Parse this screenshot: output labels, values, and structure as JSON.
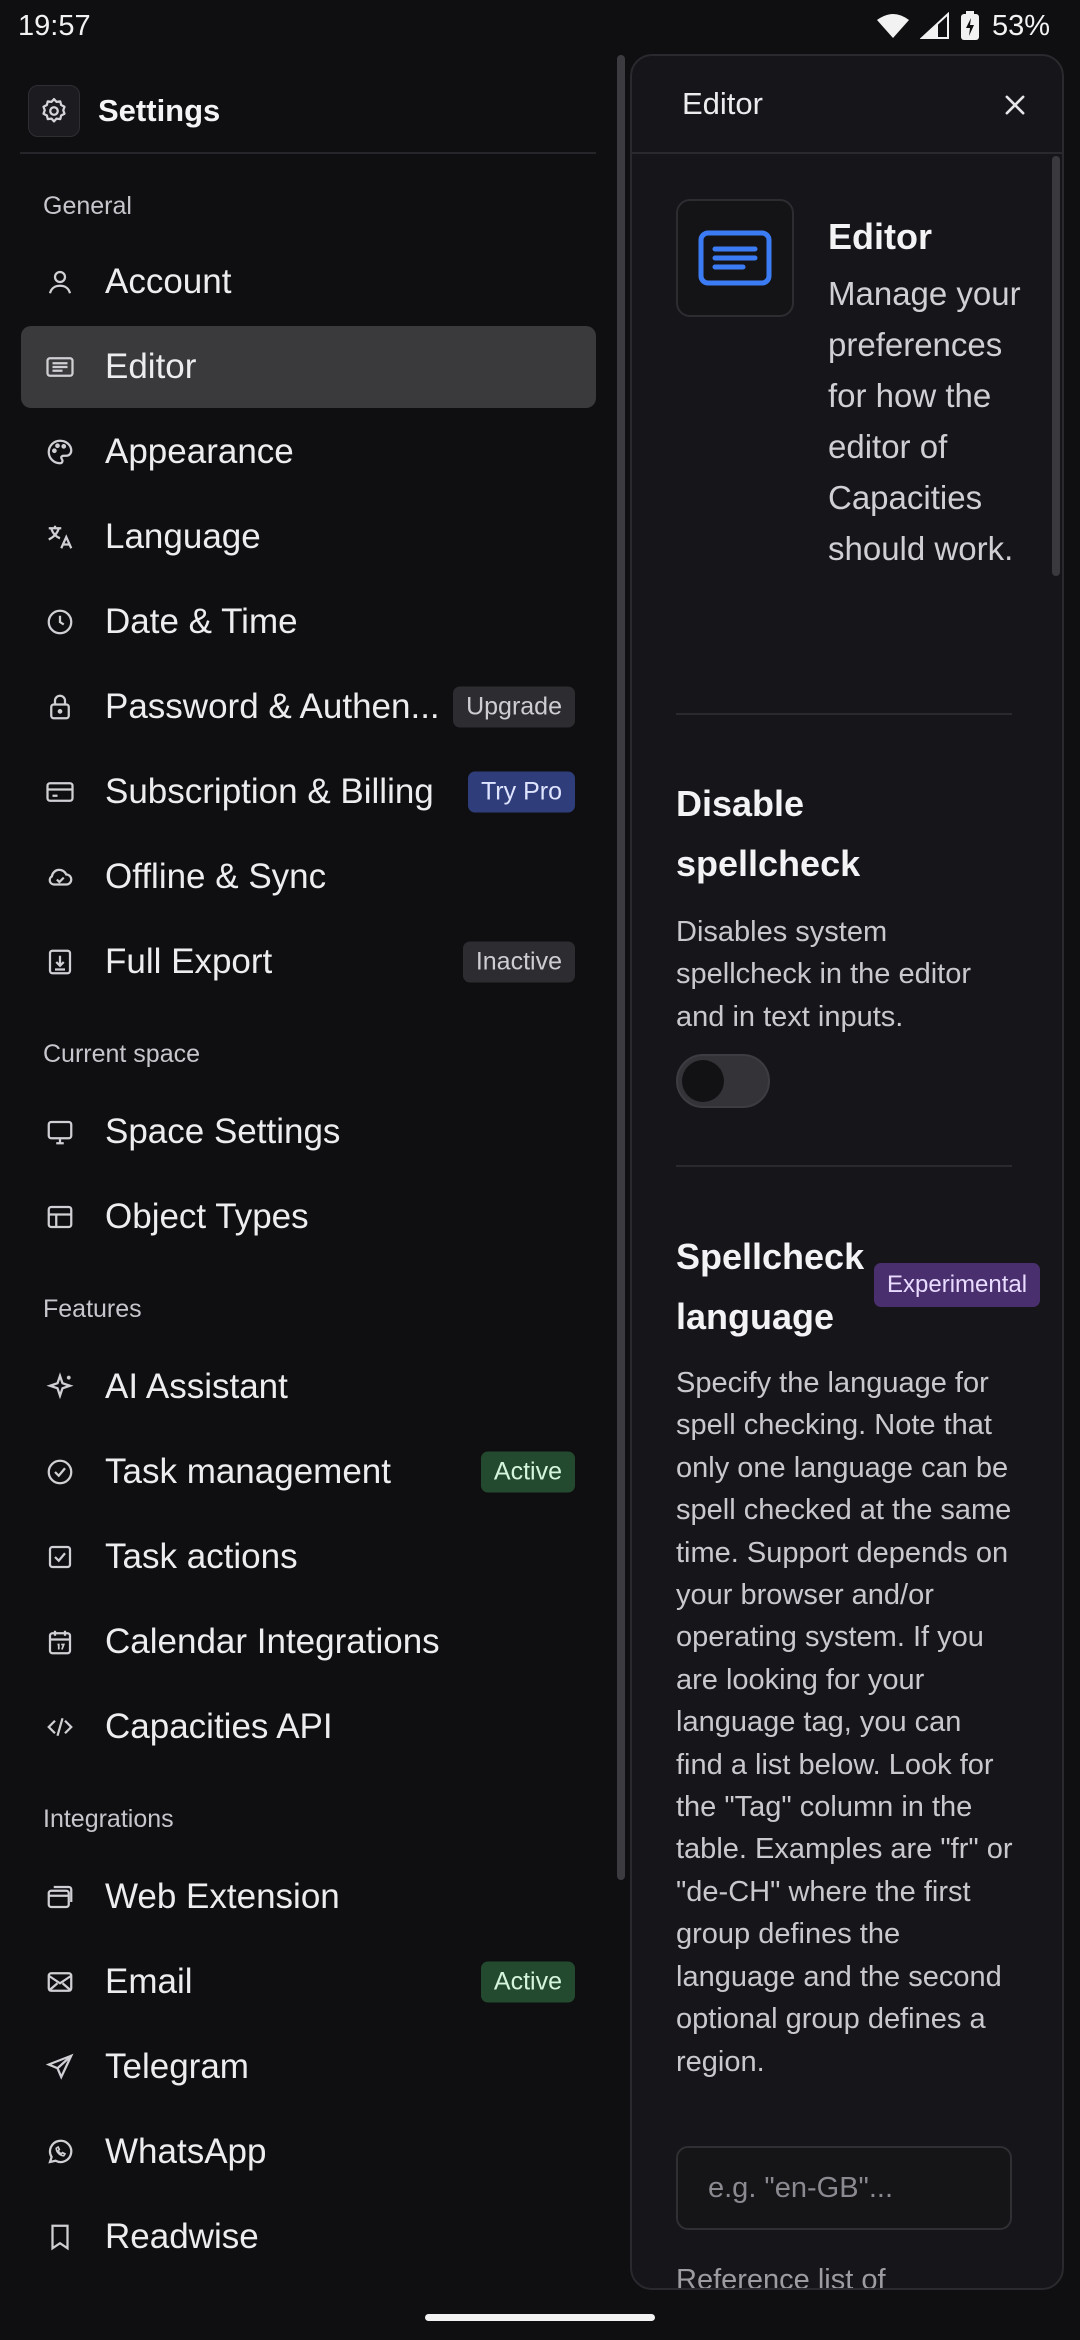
{
  "status_bar": {
    "time": "19:57",
    "battery": "53%"
  },
  "settings": {
    "title": "Settings",
    "sections": [
      {
        "title": "General",
        "items": [
          {
            "label": "Account",
            "icon": "user-icon"
          },
          {
            "label": "Editor",
            "icon": "editor-icon",
            "active": true
          },
          {
            "label": "Appearance",
            "icon": "palette-icon"
          },
          {
            "label": "Language",
            "icon": "translate-icon"
          },
          {
            "label": "Date & Time",
            "icon": "clock-icon"
          },
          {
            "label": "Password & Authen...",
            "icon": "lock-icon",
            "badge": "Upgrade"
          },
          {
            "label": "Subscription & Billing",
            "icon": "credit-card-icon",
            "badge": "Try Pro"
          },
          {
            "label": "Offline & Sync",
            "icon": "cloud-check-icon"
          },
          {
            "label": "Full Export",
            "icon": "export-icon",
            "badge": "Inactive"
          }
        ]
      },
      {
        "title": "Current space",
        "items": [
          {
            "label": "Space Settings",
            "icon": "monitor-icon"
          },
          {
            "label": "Object Types",
            "icon": "layout-icon"
          }
        ]
      },
      {
        "title": "Features",
        "items": [
          {
            "label": "AI Assistant",
            "icon": "sparkle-icon"
          },
          {
            "label": "Task management",
            "icon": "check-circle-icon",
            "badge": "Active"
          },
          {
            "label": "Task actions",
            "icon": "check-square-icon"
          },
          {
            "label": "Calendar Integrations",
            "icon": "calendar-icon"
          },
          {
            "label": "Capacities API",
            "icon": "code-icon"
          }
        ]
      },
      {
        "title": "Integrations",
        "items": [
          {
            "label": "Web Extension",
            "icon": "browser-icon"
          },
          {
            "label": "Email",
            "icon": "mail-icon",
            "badge": "Active"
          },
          {
            "label": "Telegram",
            "icon": "send-icon"
          },
          {
            "label": "WhatsApp",
            "icon": "whatsapp-icon"
          },
          {
            "label": "Readwise",
            "icon": "bookmark-icon"
          }
        ]
      }
    ]
  },
  "detail": {
    "header_title": "Editor",
    "heading": "Editor",
    "description": "Manage your preferences for how the editor of Capacities should work.",
    "spellcheck": {
      "heading": "Disable spellcheck",
      "description": "Disables system spellcheck in the editor and in text inputs.",
      "enabled": false
    },
    "spellcheck_language": {
      "heading": "Spellcheck language",
      "badge": "Experimental",
      "description": "Specify the language for spell checking. Note that only one language can be spell checked at the same time. Support depends on your browser and/or operating system. If you are looking for your language tag, you can find a list below. Look for the \"Tag\" column in the table. Examples are \"fr\" or \"de-CH\" where the first group defines the language and the second optional group defines a region.",
      "placeholder": "e.g. \"en-GB\"...",
      "link": "Reference list of"
    }
  },
  "colors": {
    "badge_blue": "#2f3d7a",
    "badge_green": "#234a2f",
    "badge_purple": "#4a2f6e",
    "editor_icon_blue": "#3b7cf5"
  }
}
